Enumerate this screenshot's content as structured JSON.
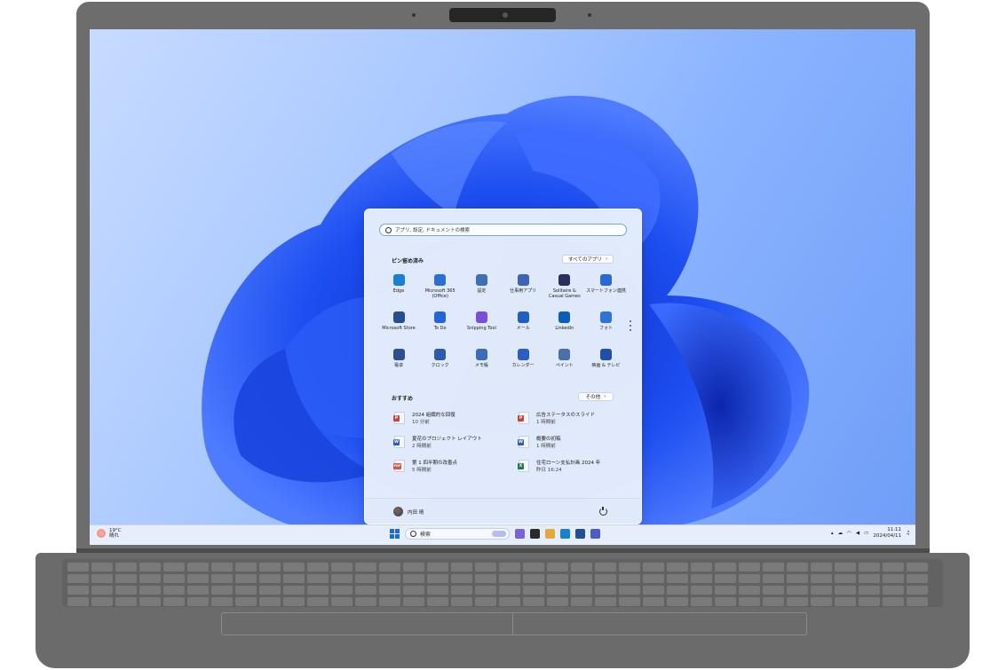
{
  "start_menu": {
    "search_placeholder": "アプリ, 設定, ドキュメントの検索",
    "pinned_title": "ピン留め済み",
    "all_apps_label": "すべてのアプリ",
    "all_apps_chevron": "›",
    "pinned_apps": [
      {
        "label": "Edge",
        "icon": "edge-icon",
        "color": "#1b7fd6"
      },
      {
        "label": "Microsoft 365\n(Office)",
        "icon": "microsoft-365-icon",
        "color": "#2a6fd1"
      },
      {
        "label": "設定",
        "icon": "gear-icon",
        "color": "#3f6fb8"
      },
      {
        "label": "仕事用アプリ",
        "icon": "work-apps-icon",
        "color": "#3d63b5"
      },
      {
        "label": "Solitaire &\nCasual Games",
        "icon": "solitaire-icon",
        "color": "#2a2f5c"
      },
      {
        "label": "スマートフォン連携",
        "icon": "phone-link-icon",
        "color": "#2a68d6"
      },
      {
        "label": "Microsoft Store",
        "icon": "store-icon",
        "color": "#23508f"
      },
      {
        "label": "To Do",
        "icon": "checkmark-icon",
        "color": "#2463d9"
      },
      {
        "label": "Snipping Tool",
        "icon": "snipping-tool-icon",
        "color": "#7a4fd6"
      },
      {
        "label": "メール",
        "icon": "mail-icon",
        "color": "#1e5fc4"
      },
      {
        "label": "LinkedIn",
        "icon": "linkedin-icon",
        "color": "#0a5db8"
      },
      {
        "label": "フォト",
        "icon": "photos-icon",
        "color": "#2d74d8"
      },
      {
        "label": "電卓",
        "icon": "calculator-icon",
        "color": "#2b4f8f"
      },
      {
        "label": "クロック",
        "icon": "clock-icon",
        "color": "#2a5aa8"
      },
      {
        "label": "メモ帳",
        "icon": "notepad-icon",
        "color": "#3a6cb8"
      },
      {
        "label": "カレンダー",
        "icon": "calendar-icon",
        "color": "#2b5ec2"
      },
      {
        "label": "ペイント",
        "icon": "paint-icon",
        "color": "#4a6fb0"
      },
      {
        "label": "映画 & テレビ",
        "icon": "movies-tv-icon",
        "color": "#1f4fa8"
      }
    ],
    "recommended_title": "おすすめ",
    "more_label": "その他",
    "more_chevron": "›",
    "recommended": [
      {
        "name": "2024 組織的な回復",
        "time": "10 分前",
        "type": "P",
        "color": "#c9453a",
        "icon": "powerpoint-file-icon"
      },
      {
        "name": "広告ステータスのスライド",
        "time": "1 時間前",
        "type": "P",
        "color": "#c9453a",
        "icon": "powerpoint-file-icon"
      },
      {
        "name": "夏花のプロジェクト レイアウト",
        "time": "2 時間前",
        "type": "W",
        "color": "#2b5cc4",
        "icon": "word-file-icon"
      },
      {
        "name": "概要の初稿",
        "time": "1 時間前",
        "type": "W",
        "color": "#2b5cc4",
        "icon": "word-file-icon"
      },
      {
        "name": "第 1 四半期の改善点",
        "time": "5 時間前",
        "type": "PDF",
        "color": "#d0574a",
        "icon": "pdf-file-icon"
      },
      {
        "name": "住宅ローン支払計画 2024 年",
        "time": "昨日 16:24",
        "type": "X",
        "color": "#1f7a4a",
        "icon": "excel-file-icon"
      }
    ],
    "user_name": "内田 晴"
  },
  "taskbar": {
    "weather_temp": "19°C",
    "weather_desc": "晴れ",
    "search_label": "検索",
    "time": "11:11",
    "date": "2024/04/11",
    "apps": [
      {
        "icon": "copilot-icon",
        "color": "#7b62d8"
      },
      {
        "icon": "task-view-icon",
        "color": "#2a2a2a"
      },
      {
        "icon": "file-explorer-icon",
        "color": "#e5a93a"
      },
      {
        "icon": "edge-icon",
        "color": "#1b7fd6"
      },
      {
        "icon": "store-icon",
        "color": "#23508f"
      },
      {
        "icon": "teams-icon",
        "color": "#4f5bc4"
      }
    ]
  },
  "colors": {
    "accent": "#1a6cd8",
    "bloom": "#1f4fe0"
  }
}
